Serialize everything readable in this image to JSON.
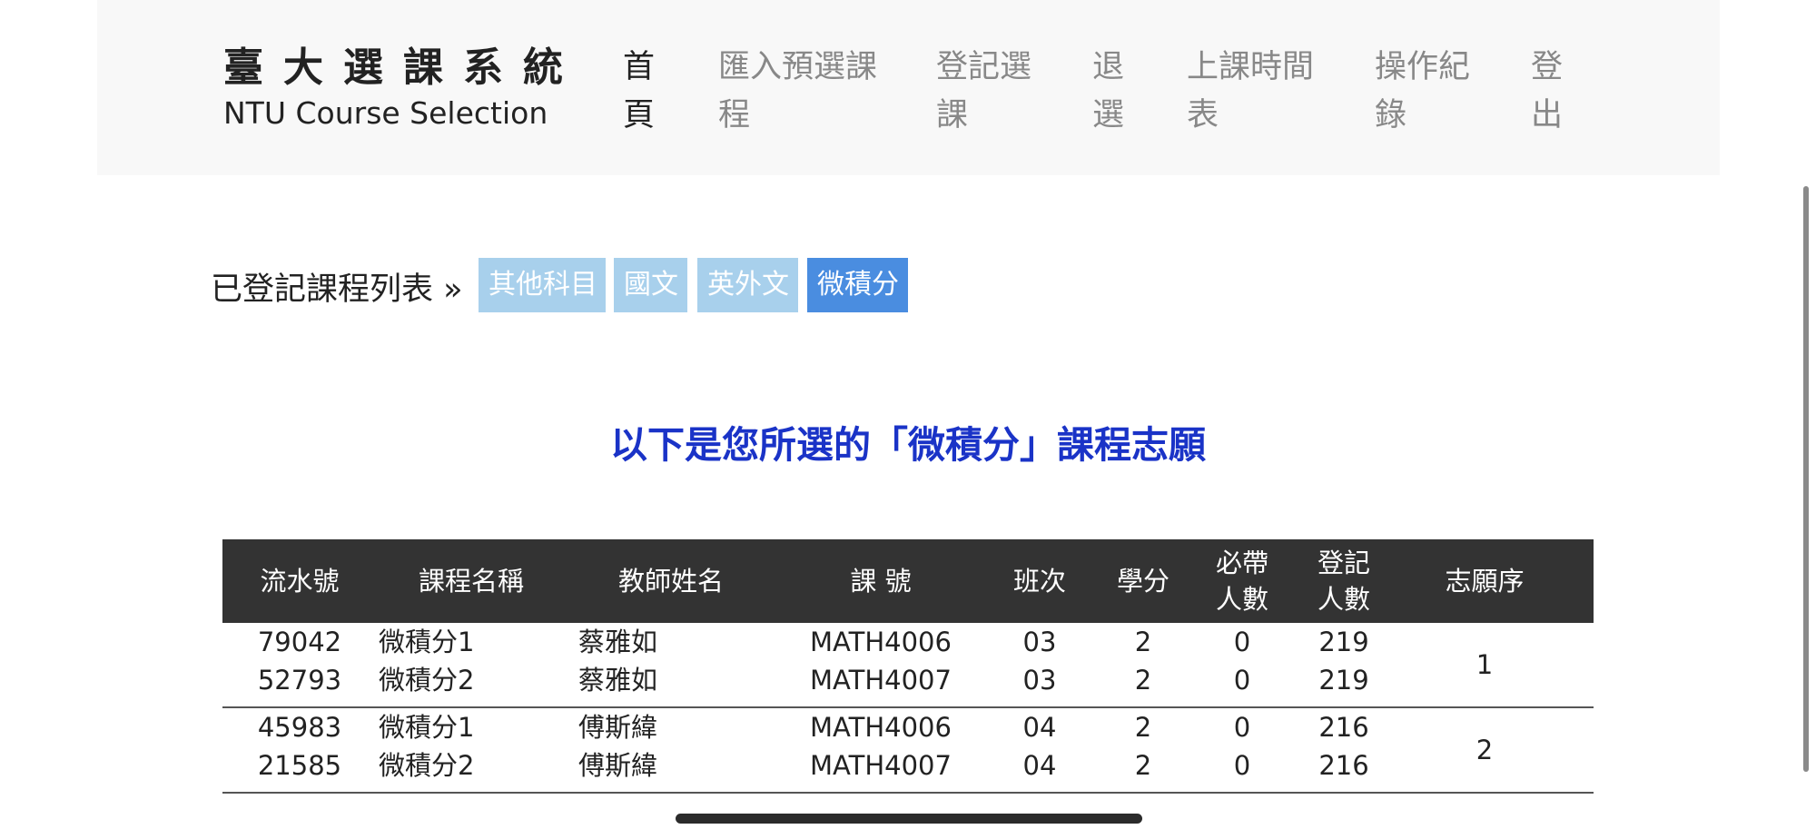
{
  "header": {
    "brand_zh": "臺大選課系統",
    "brand_en": "NTU Course Selection",
    "nav": [
      {
        "label": "首頁",
        "active": true
      },
      {
        "label": "匯入預選課程",
        "active": false
      },
      {
        "label": "登記選課",
        "active": false
      },
      {
        "label": "退選",
        "active": false
      },
      {
        "label": "上課時間表",
        "active": false
      },
      {
        "label": "操作紀錄",
        "active": false
      },
      {
        "label": "登出",
        "active": false
      }
    ]
  },
  "breadcrumb": "已登記課程列表 »",
  "category_tabs": [
    {
      "label": "其他科目",
      "active": false
    },
    {
      "label": "國文",
      "active": false
    },
    {
      "label": "英外文",
      "active": false
    },
    {
      "label": "微積分",
      "active": true
    }
  ],
  "heading": "以下是您所選的「微積分」課程志願",
  "table": {
    "headers": [
      "流水號",
      "課程名稱",
      "教師姓名",
      "課 號",
      "班次",
      "學分",
      "必帶人數",
      "登記人數",
      "志願序"
    ],
    "groups": [
      {
        "preference": "1",
        "rows": [
          {
            "serial": "79042",
            "course": "微積分1",
            "teacher": "蔡雅如",
            "code": "MATH4006",
            "class": "03",
            "credits": "2",
            "required": "0",
            "registered": "219"
          },
          {
            "serial": "52793",
            "course": "微積分2",
            "teacher": "蔡雅如",
            "code": "MATH4007",
            "class": "03",
            "credits": "2",
            "required": "0",
            "registered": "219"
          }
        ]
      },
      {
        "preference": "2",
        "rows": [
          {
            "serial": "45983",
            "course": "微積分1",
            "teacher": "傅斯緯",
            "code": "MATH4006",
            "class": "04",
            "credits": "2",
            "required": "0",
            "registered": "216"
          },
          {
            "serial": "21585",
            "course": "微積分2",
            "teacher": "傅斯緯",
            "code": "MATH4007",
            "class": "04",
            "credits": "2",
            "required": "0",
            "registered": "216"
          }
        ]
      }
    ]
  },
  "colors": {
    "tab_inactive": "#a8d0ec",
    "tab_active": "#4a8de0",
    "heading": "#1a33c7",
    "table_header": "#333333"
  }
}
